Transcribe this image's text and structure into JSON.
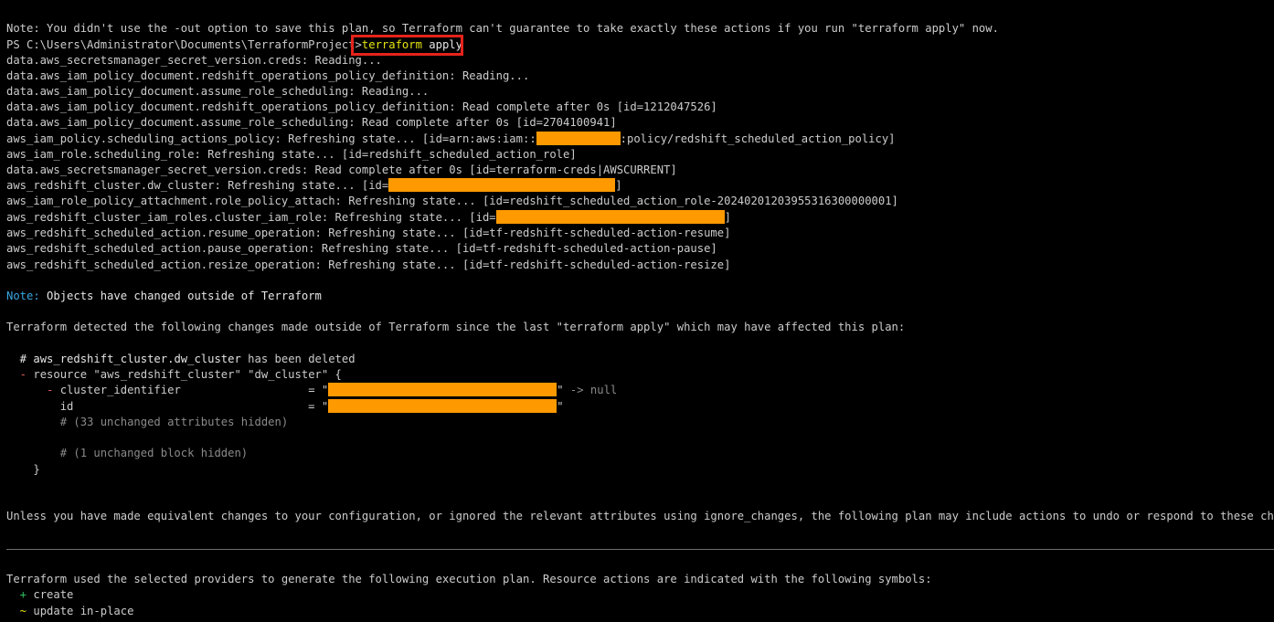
{
  "note_line": "Note: You didn't use the -out option to save this plan, so Terraform can't guarantee to take exactly these actions if you run \"terraform apply\" now.",
  "prompt": {
    "path": "PS C:\\Users\\Administrator\\Documents\\TerraformProject>",
    "command": "terraform",
    "args": "apply"
  },
  "refresh_lines": {
    "l0": "data.aws_secretsmanager_secret_version.creds: Reading...",
    "l1": "data.aws_iam_policy_document.redshift_operations_policy_definition: Reading...",
    "l2": "data.aws_iam_policy_document.assume_role_scheduling: Reading...",
    "l3": "data.aws_iam_policy_document.redshift_operations_policy_definition: Read complete after 0s [id=1212047526]",
    "l4": "data.aws_iam_policy_document.assume_role_scheduling: Read complete after 0s [id=2704100941]",
    "l5_a": "aws_iam_policy.scheduling_actions_policy: Refreshing state... [id=arn:aws:iam::",
    "l5_b": ":policy/redshift_scheduled_action_policy]",
    "l6": "aws_iam_role.scheduling_role: Refreshing state... [id=redshift_scheduled_action_role]",
    "l7": "data.aws_secretsmanager_secret_version.creds: Read complete after 0s [id=terraform-creds|AWSCURRENT]",
    "l8_a": "aws_redshift_cluster.dw_cluster: Refreshing state... [id=",
    "l8_b": "]",
    "l9": "aws_iam_role_policy_attachment.role_policy_attach: Refreshing state... [id=redshift_scheduled_action_role-20240201203955316300000001]",
    "l10_a": "aws_redshift_cluster_iam_roles.cluster_iam_role: Refreshing state... [id=",
    "l10_b": "]",
    "l11": "aws_redshift_scheduled_action.resume_operation: Refreshing state... [id=tf-redshift-scheduled-action-resume]",
    "l12": "aws_redshift_scheduled_action.pause_operation: Refreshing state... [id=tf-redshift-scheduled-action-pause]",
    "l13": "aws_redshift_scheduled_action.resize_operation: Refreshing state... [id=tf-redshift-scheduled-action-resize]"
  },
  "changed_note": {
    "label": "Note:",
    "text": " Objects have changed outside of Terraform"
  },
  "detected_line": "Terraform detected the following changes made outside of Terraform since the last \"terraform apply\" which may have affected this plan:",
  "diff": {
    "hash": "  # ",
    "resource_name": "aws_redshift_cluster.dw_cluster",
    "deleted_text": " has been deleted",
    "minus": "  - ",
    "resource_decl": "resource \"aws_redshift_cluster\" \"dw_cluster\" {",
    "attr_minus": "      - ",
    "attr1_key": "cluster_identifier                   = \"",
    "attr1_end": "\"",
    "attr1_null": " -> null",
    "attr2_key": "        id                                   = \"",
    "attr2_end": "\"",
    "hidden_attrs": "        # (33 unchanged attributes hidden)",
    "hidden_block": "        # (1 unchanged block hidden)",
    "close_brace": "    }"
  },
  "unless_line": "Unless you have made equivalent changes to your configuration, or ignored the relevant attributes using ignore_changes, the following plan may include actions to undo or respond to these changes.",
  "plan_line": "Terraform used the selected providers to generate the following execution plan. Resource actions are indicated with the following symbols:",
  "symbols": {
    "create_sym": "  + ",
    "create_text": "create",
    "update_sym": "  ~ ",
    "update_text": "update in-place"
  },
  "colors": {
    "background": "#000000",
    "text": "#cccccc",
    "note_cyan": "#3aa7e3",
    "command_yellow": "#e5e510",
    "deleted_red": "#e25f5f",
    "create_green": "#2fbf5f",
    "redaction": "#ff9900",
    "highlight_box": "#e5231b"
  }
}
